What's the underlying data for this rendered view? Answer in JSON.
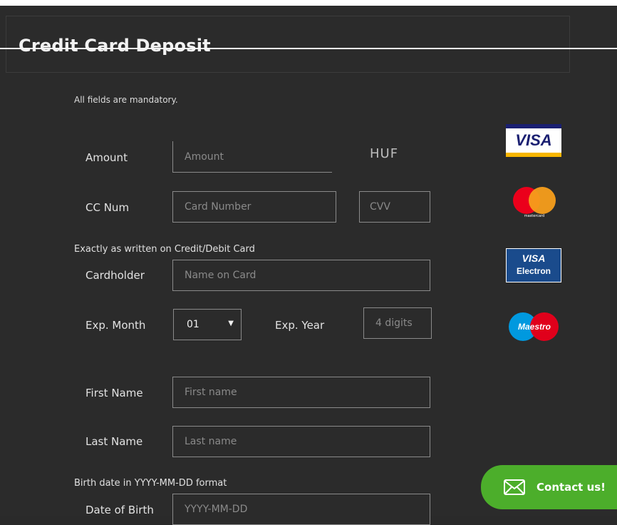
{
  "header": {
    "title": "Credit Card Deposit"
  },
  "form": {
    "note": "All fields are mandatory.",
    "amount": {
      "label": "Amount",
      "placeholder": "Amount",
      "currency": "HUF"
    },
    "cc": {
      "label": "CC Num",
      "placeholder": "Card Number",
      "cvv_placeholder": "CVV"
    },
    "card_section": "Exactly as written on Credit/Debit Card",
    "cardholder": {
      "label": "Cardholder",
      "placeholder": "Name on Card"
    },
    "exp_month": {
      "label": "Exp. Month",
      "value": "01"
    },
    "exp_year": {
      "label": "Exp. Year",
      "placeholder": "4 digits"
    },
    "first_name": {
      "label": "First Name",
      "placeholder": "First name"
    },
    "last_name": {
      "label": "Last Name",
      "placeholder": "Last name"
    },
    "birth_section": "Birth date in YYYY-MM-DD format",
    "dob": {
      "label": "Date of Birth",
      "placeholder": "YYYY-MM-DD"
    }
  },
  "cards": {
    "visa": "VISA",
    "visa_electron_top": "VISA",
    "visa_electron_bottom": "Electron",
    "maestro": "Maestro",
    "mastercard_caption": "mastercard"
  },
  "contact": {
    "label": "Contact us!"
  },
  "colors": {
    "background": "#2b2b2b",
    "accent_green": "#4cae2b"
  }
}
